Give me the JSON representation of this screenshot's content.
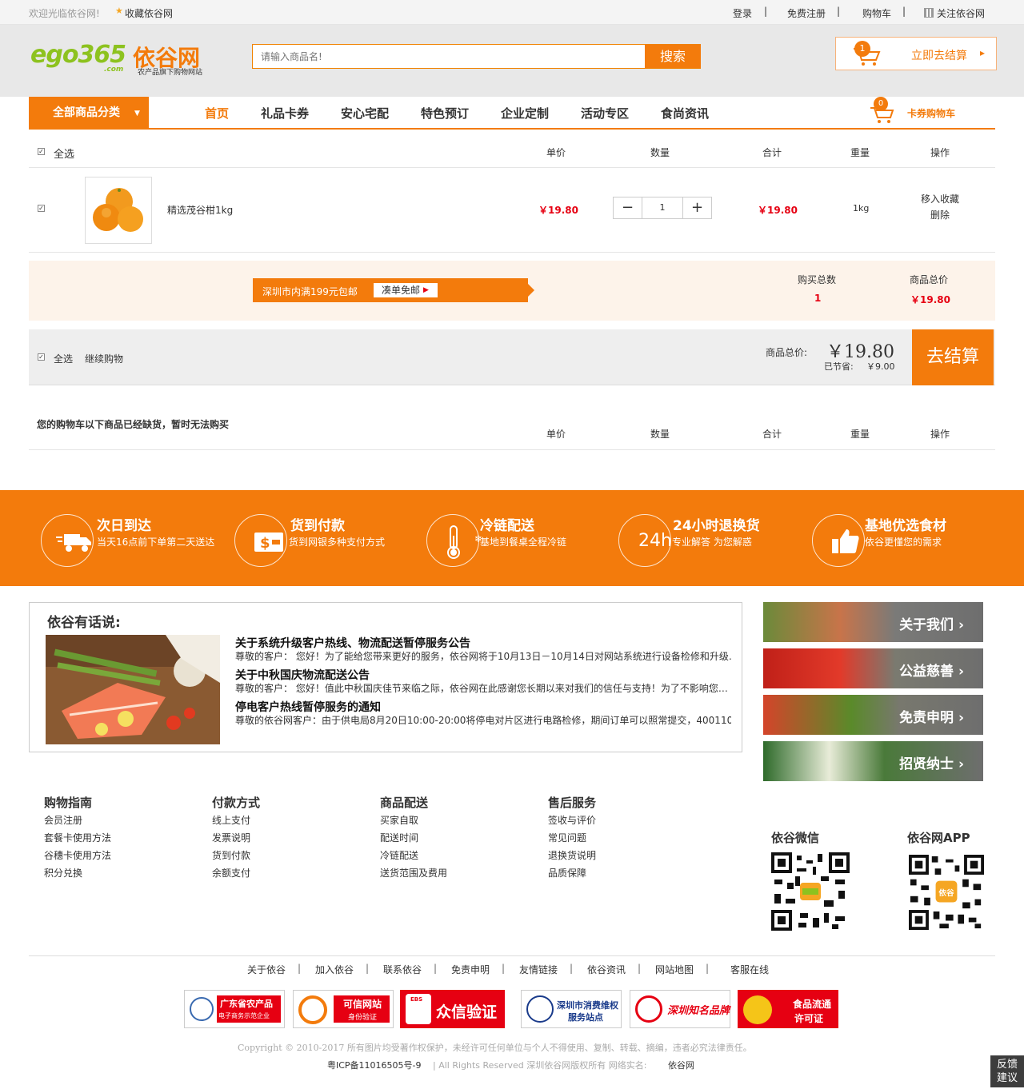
{
  "topbar": {
    "welcome": "欢迎光临依谷网!",
    "favorite": "收藏依谷网",
    "login": "登录",
    "register": "免费注册",
    "cart": "购物车",
    "follow": "关注依谷网",
    "sep": "|"
  },
  "header": {
    "logo_text": "依谷网",
    "logo_sub": "农产品旗下购物网站",
    "logo_num": "ego365",
    "logo_com": ".com",
    "search_placeholder": "请输入商品名!",
    "search_btn": "搜索",
    "checkout_count": "1",
    "checkout_label": "立即去结算"
  },
  "nav": {
    "all_categories": "全部商品分类",
    "items": [
      "首页",
      "礼品卡券",
      "安心宅配",
      "特色预订",
      "企业定制",
      "活动专区",
      "食尚资讯"
    ],
    "card_cart_count": "0",
    "card_cart": "卡券购物车"
  },
  "cart": {
    "select_all": "全选",
    "columns": [
      "单价",
      "数量",
      "合计",
      "重量",
      "操作"
    ],
    "item": {
      "name": "精选茂谷柑1kg",
      "price": "￥19.80",
      "qty": "1",
      "total": "￥19.80",
      "weight": "1kg",
      "act_fav": "移入收藏",
      "act_del": "删除"
    },
    "promo": {
      "text": "深圳市内满199元包邮",
      "btn": "凑单免邮",
      "qty_label": "购买总数",
      "qty": "1",
      "total_label": "商品总价",
      "total": "￥19.80"
    },
    "bottom": {
      "select_all": "全选",
      "continue": "继续购物",
      "total_label": "商品总价:",
      "total": "￥19.80",
      "saved_label": "已节省:",
      "saved": "￥9.00",
      "checkout": "去结算"
    },
    "oos_title": "您的购物车以下商品已经缺货，暂时无法购买"
  },
  "features": [
    {
      "icon": "truck-icon",
      "title": "次日到达",
      "sub": "当天16点前下单第二天送达"
    },
    {
      "icon": "cash-icon",
      "title": "货到付款",
      "sub": "货到网银多种支付方式"
    },
    {
      "icon": "thermometer-icon",
      "title": "冷链配送",
      "sub": "基地到餐桌全程冷链"
    },
    {
      "icon": "24h-icon",
      "icon_text": "24h",
      "title": "24小时退换货",
      "sub": "专业解答 为您解惑"
    },
    {
      "icon": "thumb-up-icon",
      "title": "基地优选食材",
      "sub": "依谷更懂您的需求"
    }
  ],
  "news": {
    "title": "依谷有话说:",
    "items": [
      {
        "title": "关于系统升级客户热线、物流配送暂停服务公告",
        "body": "尊敬的客户：  您好！为了能给您带来更好的服务，依谷网将于10月13日－10月14日对网站系统进行设备检修和升级…"
      },
      {
        "title": "关于中秋国庆物流配送公告",
        "body": "尊敬的客户：  您好！值此中秋国庆佳节来临之际，依谷网在此感谢您长期以来对我们的信任与支持！为了不影响您…"
      },
      {
        "title": "停电客户热线暂停服务的通知",
        "body": "尊敬的依谷网客户：由于供电局8月20日10:00-20:00将停电对片区进行电路检修，期间订单可以照常提交，4001100…"
      }
    ]
  },
  "side_tiles": [
    "关于我们 ›",
    "公益慈善 ›",
    "免责申明 ›",
    "招贤纳士 ›"
  ],
  "footer_cols": [
    {
      "title": "购物指南",
      "links": [
        "会员注册",
        "套餐卡使用方法",
        "谷穗卡使用方法",
        "积分兑换"
      ]
    },
    {
      "title": "付款方式",
      "links": [
        "线上支付",
        "发票说明",
        "货到付款",
        "余额支付"
      ]
    },
    {
      "title": "商品配送",
      "links": [
        "买家自取",
        "配送时间",
        "冷链配送",
        "送货范围及费用"
      ]
    },
    {
      "title": "售后服务",
      "links": [
        "签收与评价",
        "常见问题",
        "退换货说明",
        "品质保障"
      ]
    }
  ],
  "qr": {
    "wechat": "依谷微信",
    "app": "依谷网APP",
    "app_badge": "依谷"
  },
  "bottom_nav": [
    "关于依谷",
    "加入依谷",
    "联系依谷",
    "免责申明",
    "友情链接",
    "依谷资讯",
    "网站地图",
    "客服在线"
  ],
  "badges": [
    {
      "line1": "广东省农产品",
      "line2": "电子商务示范企业",
      "color": "#e60012"
    },
    {
      "line1": "可信网站",
      "line2": "身份验证",
      "color": "#e60012"
    },
    {
      "line1": "众信验证",
      "line2": "",
      "tag": "EBS",
      "color": "#e60012"
    },
    {
      "line1": "深圳市消费维权",
      "line2": "服务站点",
      "color": "#1a3b8b"
    },
    {
      "line1": "深圳知名品牌",
      "line2": "",
      "color": "#e60012"
    },
    {
      "line1": "食品流通",
      "line2": "许可证",
      "color": "#e60012"
    }
  ],
  "copyright": "Copyright © 2010-2017 所有图片均受著作权保护，未经许可任何单位与个人不得使用、复制、转载、摘编，违者必究法律责任。",
  "icp": "粤ICP备11016505号-9",
  "rights": "| All Rights Reserved 深圳依谷网版权所有 网络实名:",
  "rights_name": "依谷网",
  "feedback": "反馈建议",
  "colors": {
    "accent": "#f37b0c",
    "price": "#e60012"
  }
}
